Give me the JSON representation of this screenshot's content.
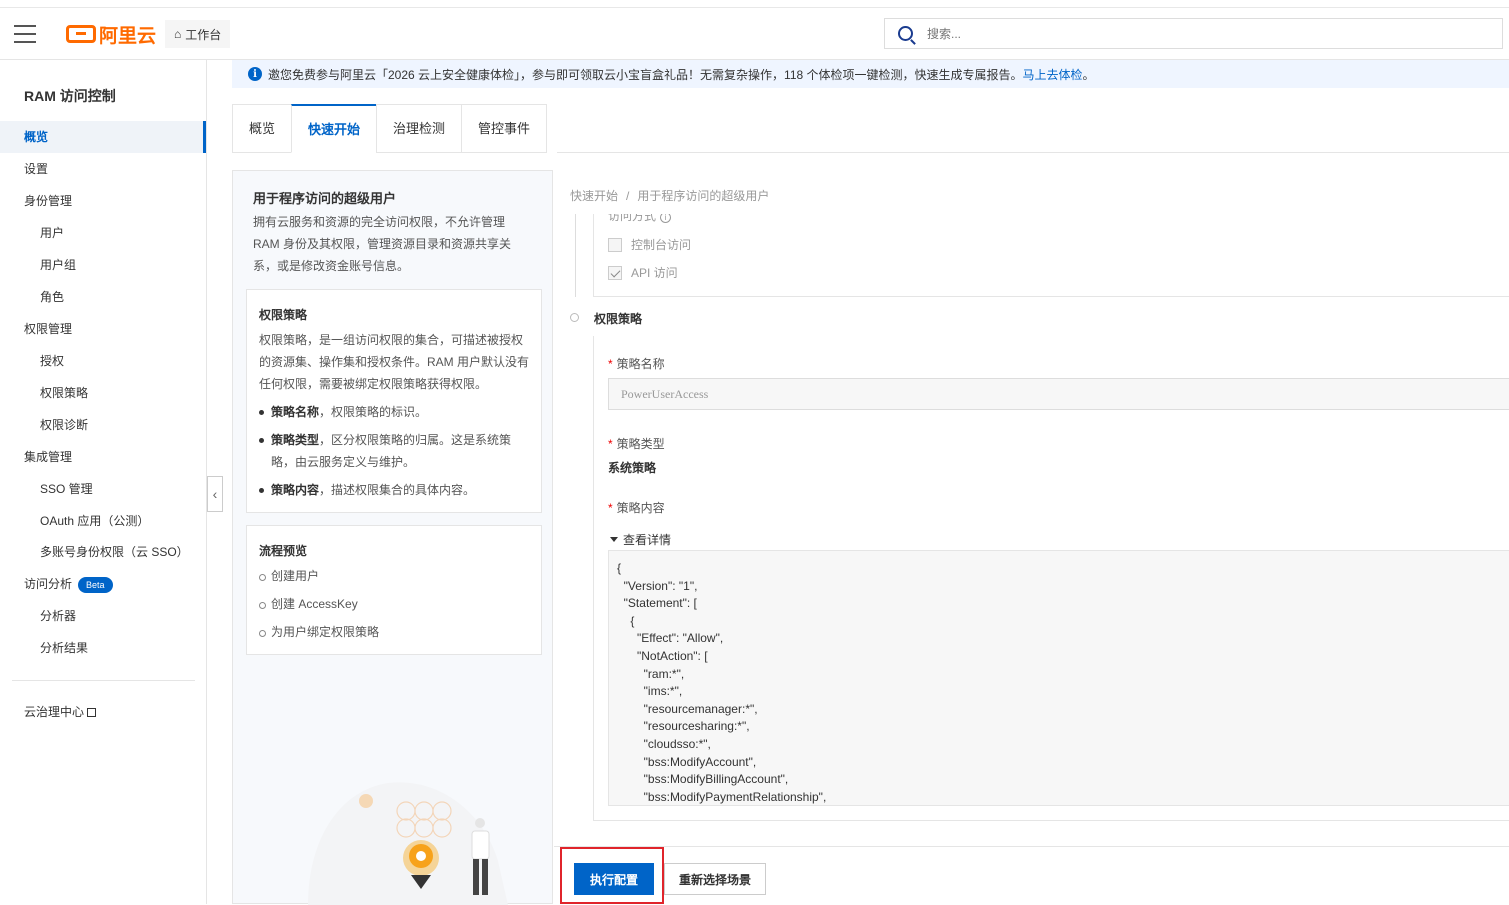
{
  "header": {
    "logo_text": "阿里云",
    "workbench_label": "工作台",
    "search_placeholder": "搜索..."
  },
  "sidebar": {
    "title": "RAM 访问控制",
    "items": [
      {
        "label": "概览",
        "level": 1,
        "active": true
      },
      {
        "label": "设置",
        "level": 1
      },
      {
        "label": "身份管理",
        "level": 1
      },
      {
        "label": "用户",
        "level": 2
      },
      {
        "label": "用户组",
        "level": 2
      },
      {
        "label": "角色",
        "level": 2
      },
      {
        "label": "权限管理",
        "level": 1
      },
      {
        "label": "授权",
        "level": 2
      },
      {
        "label": "权限策略",
        "level": 2
      },
      {
        "label": "权限诊断",
        "level": 2
      },
      {
        "label": "集成管理",
        "level": 1
      },
      {
        "label": "SSO 管理",
        "level": 2
      },
      {
        "label": "OAuth 应用（公测）",
        "level": 2
      },
      {
        "label": "多账号身份权限（云 SSO）",
        "level": 2
      },
      {
        "label": "访问分析",
        "level": 1,
        "badge": "Beta"
      },
      {
        "label": "分析器",
        "level": 2
      },
      {
        "label": "分析结果",
        "level": 2
      }
    ],
    "footer_link": "云治理中心"
  },
  "notice": {
    "text": "邀您免费参与阿里云「2026 云上安全健康体检」，参与即可领取云小宝盲盒礼品！无需复杂操作，118 个体检项一键检测，快速生成专属报告。",
    "link": "马上去体检",
    "end": "。"
  },
  "tabs": [
    {
      "label": "概览"
    },
    {
      "label": "快速开始",
      "active": true
    },
    {
      "label": "治理检测"
    },
    {
      "label": "管控事件"
    }
  ],
  "left_panel": {
    "title": "用于程序访问的超级用户",
    "description": "拥有云服务和资源的完全访问权限，不允许管理 RAM 身份及其权限，管理资源目录和资源共享关系，或是修改资金账号信息。",
    "policy_card": {
      "title": "权限策略",
      "body": "权限策略，是一组访问权限的集合，可描述被授权的资源集、操作集和授权条件。RAM 用户默认没有任何权限，需要被绑定权限策略获得权限。",
      "bullets": [
        {
          "bold": "策略名称",
          "text": "，权限策略的标识。"
        },
        {
          "bold": "策略类型",
          "text": "，区分权限策略的归属。这是系统策略，由云服务定义与维护。"
        },
        {
          "bold": "策略内容",
          "text": "，描述权限集合的具体内容。"
        }
      ]
    },
    "flow_card": {
      "title": "流程预览",
      "steps": [
        "创建用户",
        "创建 AccessKey",
        "为用户绑定权限策略"
      ]
    }
  },
  "right_panel": {
    "breadcrumb": [
      "快速开始",
      "用于程序访问的超级用户"
    ],
    "access_label": "访问方式",
    "checkbox_console": {
      "label": "控制台访问",
      "checked": false
    },
    "checkbox_api": {
      "label": "API 访问",
      "checked": true
    },
    "step_title": "权限策略",
    "policy_name_label": "策略名称",
    "policy_name_value": "PowerUserAccess",
    "policy_type_label": "策略类型",
    "policy_type_value": "系统策略",
    "policy_content_label": "策略内容",
    "toggle_label": "查看详情",
    "policy_json": "{\n  \"Version\": \"1\",\n  \"Statement\": [\n    {\n      \"Effect\": \"Allow\",\n      \"NotAction\": [\n        \"ram:*\",\n        \"ims:*\",\n        \"resourcemanager:*\",\n        \"resourcesharing:*\",\n        \"cloudsso:*\",\n        \"bss:ModifyAccount\",\n        \"bss:ModifyBillingAccount\",\n        \"bss:ModifyPaymentRelationship\","
  },
  "buttons": {
    "execute": "执行配置",
    "reselect": "重新选择场景"
  },
  "colors": {
    "primary": "#0064c8",
    "brand": "#ff6a00",
    "highlight": "#e0242b"
  }
}
